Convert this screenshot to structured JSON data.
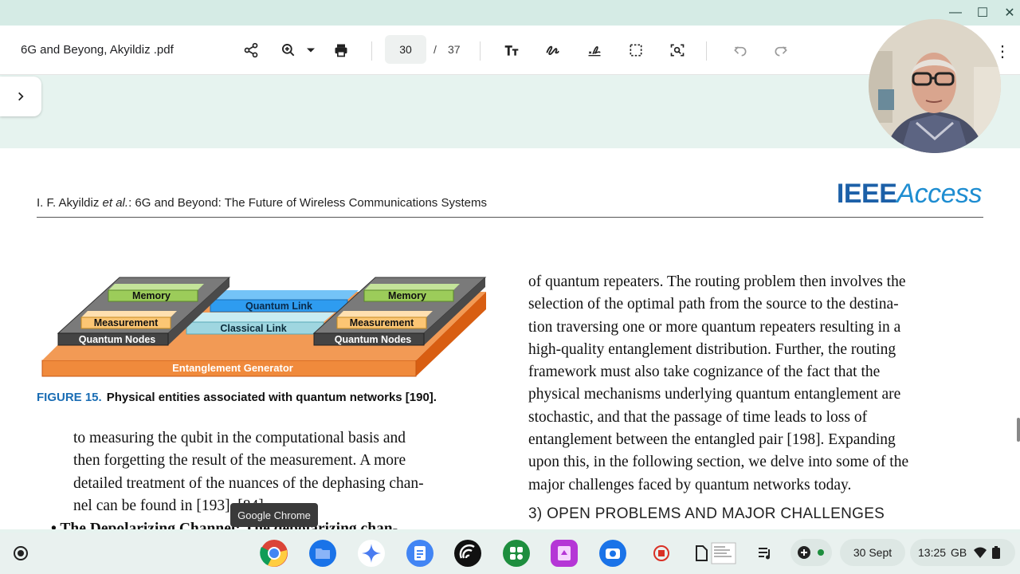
{
  "window": {
    "minimize": "—",
    "maximize": "☐",
    "close": "✕"
  },
  "toolbar": {
    "doc_title": "6G and Beyong, Akyildiz .pdf",
    "page_current": "30",
    "page_sep": "/",
    "page_total": "37",
    "more": "⋮"
  },
  "page": {
    "running_head_a": "I. F. Akyildiz ",
    "running_head_etal": "et al.",
    "running_head_b": ": 6G and Beyond: The Future of Wireless Communications Systems",
    "logo_bold": "IEEE",
    "logo_italic": "Access",
    "figure": {
      "memory_left": "Memory",
      "memory_right": "Memory",
      "measurement_left": "Measurement",
      "measurement_right": "Measurement",
      "nodes_left": "Quantum Nodes",
      "nodes_right": "Quantum Nodes",
      "quantum_link": "Quantum Link",
      "classical_link": "Classical Link",
      "generator": "Entanglement Generator"
    },
    "caption_label": "FIGURE 15.",
    "caption_text": "Physical entities associated with quantum networks [190].",
    "left_col": [
      "to measuring the qubit in the computational basis and",
      "then forgetting the result of the measurement. A more",
      "detailed treatment of the nuances of the dephasing chan-",
      "nel can be found in [193], [84]."
    ],
    "left_bullet": "• The Depolarizing Channel: The depolarizing chan-",
    "right_col": [
      "of quantum repeaters. The routing problem then involves the",
      "selection of the optimal path from the source to the destina-",
      "tion traversing one or more quantum repeaters resulting in a",
      "high-quality entanglement distribution. Further, the routing",
      "framework must also take cognizance of the fact that the",
      "physical mechanisms underlying quantum entanglement are",
      "stochastic, and that the passage of time leads to loss of",
      "entanglement between the entangled pair [198]. Expanding",
      "upon this, in the following section, we delve into some of the",
      "major challenges faced by quantum networks today."
    ],
    "section_heading": "3)  OPEN PROBLEMS AND MAJOR CHALLENGES"
  },
  "tooltip": "Google Chrome",
  "shelf": {
    "date": "30 Sept",
    "time": "13:25",
    "region": "GB"
  },
  "colors": {
    "figure_orange": "#f08a3c",
    "figure_grey": "#7a7a7a",
    "memory_green": "#9ccc5a",
    "measurement_yellow": "#fcc674",
    "quantum_link_blue": "#2e9cf0",
    "classical_link_cyan": "#9fd6e0",
    "caption_blue": "#1a6db4"
  }
}
